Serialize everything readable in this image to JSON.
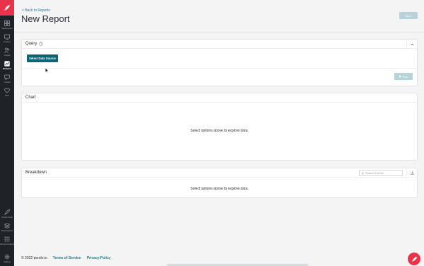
{
  "sidebar": {
    "top_items": [
      {
        "label": "Dashboards",
        "icon": "dashboard-icon"
      },
      {
        "label": "Product",
        "icon": "product-icon"
      },
      {
        "label": "People",
        "icon": "people-icon"
      },
      {
        "label": "Behavior",
        "icon": "behavior-icon"
      },
      {
        "label": "Guides",
        "icon": "guides-icon"
      },
      {
        "label": "NPS",
        "icon": "nps-icon"
      }
    ],
    "bottom_items": [
      {
        "label": "Pendo Tools",
        "icon": "pendo-tools-icon"
      },
      {
        "label": "Subscriptions",
        "icon": "subscriptions-icon"
      },
      {
        "label": "Pendo Products",
        "icon": "pendo-products-icon"
      },
      {
        "label": "Settings",
        "icon": "settings-icon"
      }
    ],
    "active": "Behavior",
    "brand_color": "#e8344b"
  },
  "header": {
    "back_label": "< Back to Reports",
    "title": "New Report",
    "save_label": "Save"
  },
  "query": {
    "title": "Query",
    "select_source_label": "Select Data Source",
    "run_label": "Run"
  },
  "chart_panel": {
    "title": "Chart",
    "empty_message": "Select options above to explore data."
  },
  "breakdown": {
    "title": "Breakdown",
    "search_placeholder": "Search events",
    "empty_message": "Select options above to explore data."
  },
  "footer": {
    "copyright": "© 2022 pendo.io",
    "terms": "Terms of Service",
    "privacy": "Privacy Policy"
  },
  "colors": {
    "accent": "#128297",
    "primary_button": "#0c6576",
    "disabled_button": "#b7d3d9"
  }
}
